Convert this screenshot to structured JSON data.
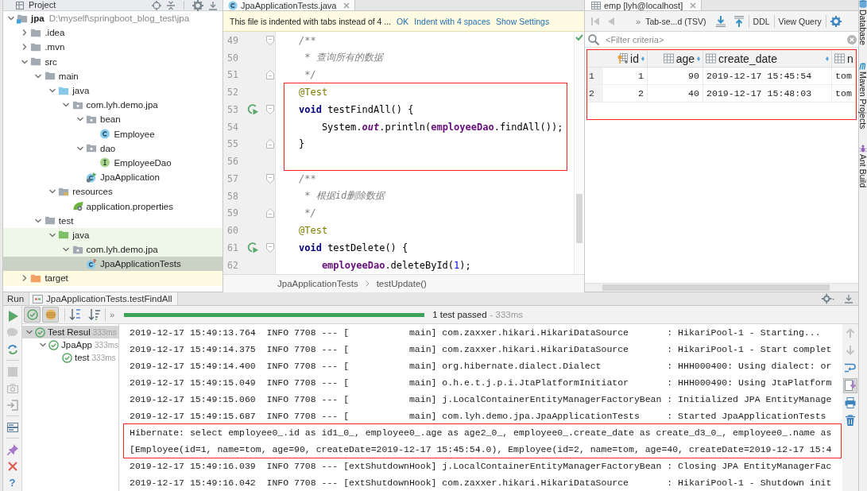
{
  "project_panel": {
    "title": "Project",
    "tree": [
      {
        "label": "jpa",
        "kind": "module",
        "note": "D:\\myself\\springboot_blog_test\\jpa",
        "expanded": true,
        "selected": false,
        "test_source": false,
        "excluded": false,
        "children": [
          {
            "label": ".idea",
            "kind": "folder",
            "expanded": false,
            "selected": false,
            "test_source": false,
            "excluded": false
          },
          {
            "label": ".mvn",
            "kind": "folder",
            "expanded": false,
            "selected": false,
            "test_source": false,
            "excluded": false
          },
          {
            "label": "src",
            "kind": "folder",
            "expanded": true,
            "selected": false,
            "test_source": false,
            "excluded": false,
            "children": [
              {
                "label": "main",
                "kind": "folder",
                "expanded": true,
                "selected": false,
                "test_source": false,
                "excluded": false,
                "children": [
                  {
                    "label": "java",
                    "kind": "source-root",
                    "expanded": true,
                    "selected": false,
                    "test_source": false,
                    "excluded": false,
                    "children": [
                      {
                        "label": "com.lyh.demo.jpa",
                        "kind": "package",
                        "expanded": true,
                        "selected": false,
                        "test_source": false,
                        "excluded": false,
                        "children": [
                          {
                            "label": "bean",
                            "kind": "package",
                            "expanded": true,
                            "selected": false,
                            "test_source": false,
                            "excluded": false,
                            "children": [
                              {
                                "label": "Employee",
                                "kind": "class",
                                "selected": false,
                                "test_source": false,
                                "excluded": false
                              }
                            ]
                          },
                          {
                            "label": "dao",
                            "kind": "package",
                            "expanded": true,
                            "selected": false,
                            "test_source": false,
                            "excluded": false,
                            "children": [
                              {
                                "label": "EmployeeDao",
                                "kind": "interface",
                                "selected": false,
                                "test_source": false,
                                "excluded": false
                              }
                            ]
                          },
                          {
                            "label": "JpaApplication",
                            "kind": "application-class",
                            "selected": false,
                            "test_source": false,
                            "excluded": false
                          }
                        ]
                      }
                    ]
                  },
                  {
                    "label": "resources",
                    "kind": "resources-root",
                    "expanded": true,
                    "selected": false,
                    "test_source": false,
                    "excluded": false,
                    "children": [
                      {
                        "label": "application.properties",
                        "kind": "properties",
                        "selected": false,
                        "test_source": false,
                        "excluded": false
                      }
                    ]
                  }
                ]
              },
              {
                "label": "test",
                "kind": "folder",
                "expanded": true,
                "selected": false,
                "test_source": false,
                "excluded": false,
                "children": [
                  {
                    "label": "java",
                    "kind": "test-root",
                    "expanded": true,
                    "selected": false,
                    "test_source": true,
                    "excluded": false,
                    "children": [
                      {
                        "label": "com.lyh.demo.jpa",
                        "kind": "package",
                        "expanded": true,
                        "selected": false,
                        "test_source": true,
                        "excluded": false,
                        "children": [
                          {
                            "label": "JpaApplicationTests",
                            "kind": "test-class",
                            "selected": true,
                            "test_source": true,
                            "excluded": false
                          }
                        ]
                      }
                    ]
                  }
                ]
              }
            ]
          },
          {
            "label": "target",
            "kind": "excluded-folder",
            "expanded": false,
            "selected": false,
            "test_source": false,
            "excluded": true
          }
        ]
      }
    ]
  },
  "editor": {
    "tab": {
      "label": "JpaApplicationTests.java",
      "selected": true
    },
    "notice": {
      "text": "This file is indented with tabs instead of 4 ...",
      "actions": [
        "OK",
        "Indent with 4 spaces",
        "Show Settings"
      ]
    },
    "lines": [
      {
        "number": "49",
        "fold_start": true,
        "fold_end": false,
        "runnable": false,
        "boxed": false,
        "tokens": [
          {
            "kind": "comment",
            "text": "/**"
          }
        ]
      },
      {
        "number": "50",
        "fold_start": false,
        "fold_end": false,
        "runnable": false,
        "boxed": false,
        "tokens": [
          {
            "kind": "comment",
            "text": " * 查询所有的数据"
          }
        ]
      },
      {
        "number": "51",
        "fold_start": false,
        "fold_end": true,
        "runnable": false,
        "boxed": false,
        "tokens": [
          {
            "kind": "comment",
            "text": " */"
          }
        ]
      },
      {
        "number": "52",
        "fold_start": false,
        "fold_end": false,
        "runnable": false,
        "boxed": true,
        "tokens": [
          {
            "kind": "annotation",
            "text": "@Test"
          }
        ]
      },
      {
        "number": "53",
        "fold_start": true,
        "fold_end": false,
        "runnable": true,
        "boxed": true,
        "tokens": [
          {
            "kind": "keyword",
            "text": "void"
          },
          {
            "kind": "plain",
            "text": " testFindAll() {"
          }
        ]
      },
      {
        "number": "54",
        "fold_start": false,
        "fold_end": false,
        "runnable": false,
        "boxed": true,
        "tokens": [
          {
            "kind": "plain",
            "text": "    System."
          },
          {
            "kind": "static-field",
            "text": "out"
          },
          {
            "kind": "plain",
            "text": ".println("
          },
          {
            "kind": "field",
            "text": "employeeDao"
          },
          {
            "kind": "plain",
            "text": ".findAll());"
          }
        ]
      },
      {
        "number": "55",
        "fold_start": false,
        "fold_end": true,
        "runnable": false,
        "boxed": true,
        "tokens": [
          {
            "kind": "plain",
            "text": "}"
          }
        ]
      },
      {
        "number": "56",
        "fold_start": false,
        "fold_end": false,
        "runnable": false,
        "boxed": true
      },
      {
        "number": "57",
        "fold_start": true,
        "fold_end": false,
        "runnable": false,
        "boxed": false,
        "tokens": [
          {
            "kind": "comment",
            "text": "/**"
          }
        ]
      },
      {
        "number": "58",
        "fold_start": false,
        "fold_end": false,
        "runnable": false,
        "boxed": false,
        "tokens": [
          {
            "kind": "comment",
            "text": " * 根据id删除数据"
          }
        ]
      },
      {
        "number": "59",
        "fold_start": false,
        "fold_end": true,
        "runnable": false,
        "boxed": false,
        "tokens": [
          {
            "kind": "comment",
            "text": " */"
          }
        ]
      },
      {
        "number": "60",
        "fold_start": false,
        "fold_end": false,
        "runnable": false,
        "boxed": false,
        "tokens": [
          {
            "kind": "annotation",
            "text": "@Test"
          }
        ]
      },
      {
        "number": "61",
        "fold_start": true,
        "fold_end": false,
        "runnable": true,
        "boxed": false,
        "tokens": [
          {
            "kind": "keyword",
            "text": "void"
          },
          {
            "kind": "plain",
            "text": " testDelete() {"
          }
        ]
      },
      {
        "number": "62",
        "fold_start": false,
        "fold_end": false,
        "runnable": false,
        "boxed": false,
        "tokens": [
          {
            "kind": "field",
            "text": "    employeeDao"
          },
          {
            "kind": "plain",
            "text": ".deleteById("
          },
          {
            "kind": "number",
            "text": "1"
          },
          {
            "kind": "plain",
            "text": ");"
          }
        ]
      }
    ],
    "breadcrumbs": [
      "JpaApplicationTests",
      "testUpdate()"
    ]
  },
  "database_panel": {
    "tab": {
      "label": "emp [lyh@localhost]",
      "selected": true
    },
    "toolbar": {
      "more": "»",
      "format": "Tab-se...d (TSV)",
      "buttons": [
        "DDL",
        "View Query"
      ]
    },
    "filter": {
      "placeholder": "<Filter criteria>"
    },
    "table": {
      "boxed": true,
      "columns": [
        {
          "label": "id",
          "kind": "key"
        },
        {
          "label": "age",
          "kind": "number"
        },
        {
          "label": "create_date",
          "kind": "datetime"
        },
        {
          "label": "n",
          "kind": "text"
        }
      ],
      "rows": [
        {
          "number": "1",
          "cells": [
            "1",
            "90",
            "2019-12-17 15:45:54",
            "tom"
          ]
        },
        {
          "number": "2",
          "cells": [
            "2",
            "40",
            "2019-12-17 15:48:03",
            "tom"
          ]
        }
      ]
    }
  },
  "side_tabs": [
    {
      "label": "Database",
      "kind": "database"
    },
    {
      "label": "Maven Projects",
      "kind": "maven"
    },
    {
      "label": "Ant Build",
      "kind": "ant"
    }
  ],
  "run_panel": {
    "title": "Run",
    "tab": {
      "label": "JpaApplicationTests.testFindAll",
      "selected": true
    },
    "filters": [
      {
        "kind": "passed",
        "on": true
      },
      {
        "kind": "ignored",
        "on": true
      }
    ],
    "more": "»",
    "progress": {
      "level": 1,
      "status": "1 test passed",
      "duration": "- 333ms"
    },
    "tests": [
      {
        "label": "Test Resul",
        "time": "333ms",
        "passed": true,
        "expanded": true,
        "selected": true,
        "children": [
          {
            "label": "JpaApp",
            "time": "333ms",
            "passed": true,
            "expanded": true,
            "selected": false,
            "children": [
              {
                "label": "test",
                "time": "333ms",
                "passed": true,
                "selected": false
              }
            ]
          }
        ]
      }
    ],
    "console": [
      {
        "text": "2019-12-17 15:49:13.764  INFO 7708 --- [           main] com.zaxxer.hikari.HikariDataSource       : HikariPool-1 - Starting...",
        "boxed": false
      },
      {
        "text": "2019-12-17 15:49:14.375  INFO 7708 --- [           main] com.zaxxer.hikari.HikariDataSource       : HikariPool-1 - Start complet",
        "boxed": false
      },
      {
        "text": "2019-12-17 15:49:14.400  INFO 7708 --- [           main] org.hibernate.dialect.Dialect            : HHH000400: Using dialect: or",
        "boxed": false
      },
      {
        "text": "2019-12-17 15:49:15.049  INFO 7708 --- [           main] o.h.e.t.j.p.i.JtaPlatformInitiator       : HHH000490: Using JtaPlatform",
        "boxed": false
      },
      {
        "text": "2019-12-17 15:49:15.060  INFO 7708 --- [           main] j.LocalContainerEntityManagerFactoryBean : Initialized JPA EntityManage",
        "boxed": false
      },
      {
        "text": "2019-12-17 15:49:15.687  INFO 7708 --- [           main] com.lyh.demo.jpa.JpaApplicationTests     : Started JpaApplicationTests",
        "boxed": false
      },
      {
        "text": "Hibernate: select employee0_.id as id1_0_, employee0_.age as age2_0_, employee0_.create_date as create_d3_0_, employee0_.name as",
        "boxed": true
      },
      {
        "text": "[Employee(id=1, name=tom, age=90, createDate=2019-12-17 15:45:54.0), Employee(id=2, name=tom, age=40, createDate=2019-12-17 15:4",
        "boxed": true
      },
      {
        "text": "2019-12-17 15:49:16.039  INFO 7708 --- [extShutdownHook] j.LocalContainerEntityManagerFactoryBean : Closing JPA EntityManagerFac",
        "boxed": false
      },
      {
        "text": "2019-12-17 15:49:16.042  INFO 7708 --- [extShutdownHook] com.zaxxer.hikari.HikariDataSource       : HikariPool-1 - Shutdown init",
        "boxed": false
      }
    ],
    "scroll_to_end": true,
    "help": "?"
  }
}
